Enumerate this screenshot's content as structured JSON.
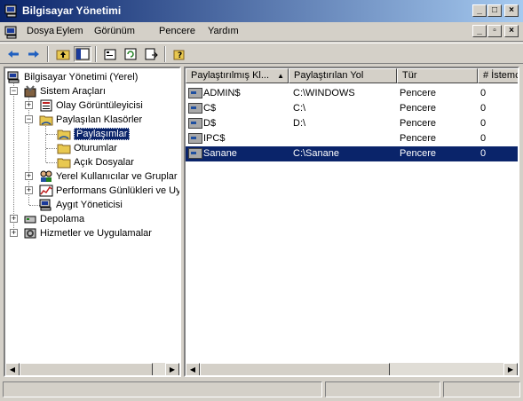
{
  "window": {
    "title": "Bilgisayar Yönetimi"
  },
  "menu": {
    "items": [
      "Dosya",
      "Eylem",
      "Görünüm",
      "Pencere",
      "Yardım"
    ]
  },
  "tree": {
    "items": [
      {
        "label": "Bilgisayar Yönetimi (Yerel)"
      },
      {
        "label": "Sistem Araçları"
      },
      {
        "label": "Olay Görüntüleyicisi"
      },
      {
        "label": "Paylaşılan Klasörler"
      },
      {
        "label": "Paylaşımlar"
      },
      {
        "label": "Oturumlar"
      },
      {
        "label": "Açık Dosyalar"
      },
      {
        "label": "Yerel Kullanıcılar ve Gruplar"
      },
      {
        "label": "Performans Günlükleri ve Uya"
      },
      {
        "label": "Aygıt Yöneticisi"
      },
      {
        "label": "Depolama"
      },
      {
        "label": "Hizmetler ve Uygulamalar"
      }
    ]
  },
  "list": {
    "columns": [
      "Paylaştırılmış Kl...",
      "Paylaştırılan Yol",
      "Tür",
      "# İstemci"
    ],
    "rows": [
      {
        "name": "ADMIN$",
        "path": "C:\\WINDOWS",
        "type": "Pencere",
        "clients": "0"
      },
      {
        "name": "C$",
        "path": "C:\\",
        "type": "Pencere",
        "clients": "0"
      },
      {
        "name": "D$",
        "path": "D:\\",
        "type": "Pencere",
        "clients": "0"
      },
      {
        "name": "IPC$",
        "path": "",
        "type": "Pencere",
        "clients": "0"
      },
      {
        "name": "Sanane",
        "path": "C:\\Sanane",
        "type": "Pencere",
        "clients": "0"
      }
    ]
  }
}
